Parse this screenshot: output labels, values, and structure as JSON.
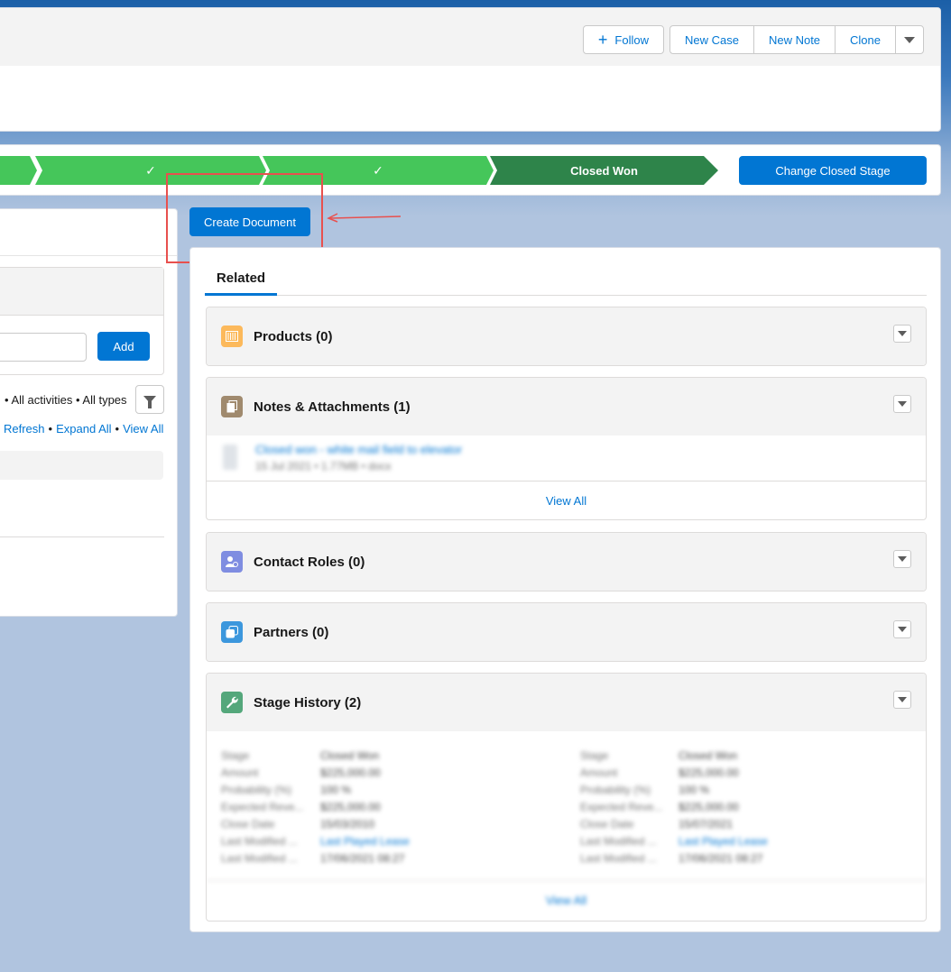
{
  "header": {
    "actions": {
      "follow": "Follow",
      "new_case": "New Case",
      "new_note": "New Note",
      "clone": "Clone"
    }
  },
  "path": {
    "check": "✓",
    "current_stage": "Closed Won",
    "change_stage_button": "Change Closed Stage"
  },
  "activity": {
    "add_button": "Add",
    "filter_text": "• All activities • All types",
    "links": {
      "refresh": "Refresh",
      "expand_all": "Expand All",
      "view_all": "View All"
    }
  },
  "create_document_button": "Create Document",
  "colors": {
    "brand": "#0176d3",
    "path_complete": "#45c65a",
    "path_current": "#2e844a",
    "annotation": "#e8504e"
  },
  "related": {
    "tab_label": "Related",
    "products": {
      "title": "Products (0)",
      "icon": "products-icon"
    },
    "notes": {
      "title": "Notes & Attachments (1)",
      "icon": "notes-icon",
      "item_link": "Closed won - white mail field to elevator",
      "item_meta": "15 Jul 2021 • 1.77MB • docx",
      "view_all": "View All"
    },
    "contact_roles": {
      "title": "Contact Roles (0)",
      "icon": "contact-roles-icon"
    },
    "partners": {
      "title": "Partners (0)",
      "icon": "partners-icon"
    },
    "stage_history": {
      "title": "Stage History (2)",
      "icon": "wrench-icon",
      "labels": [
        "Stage",
        "Amount",
        "Probability (%)",
        "Expected Reve...",
        "Close Date",
        "Last Modified ...",
        "Last Modified ..."
      ],
      "records": [
        {
          "values": [
            "Closed Won",
            "$225,000.00",
            "100 %",
            "$225,000.00",
            "15/03/2010",
            "Last Played Lease",
            "17/06/2021 08:27"
          ]
        },
        {
          "values": [
            "Closed Won",
            "$225,000.00",
            "100 %",
            "$225,000.00",
            "15/07/2021",
            "Last Played Lease",
            "17/06/2021 08:27"
          ]
        }
      ],
      "view_all": "View All"
    }
  }
}
